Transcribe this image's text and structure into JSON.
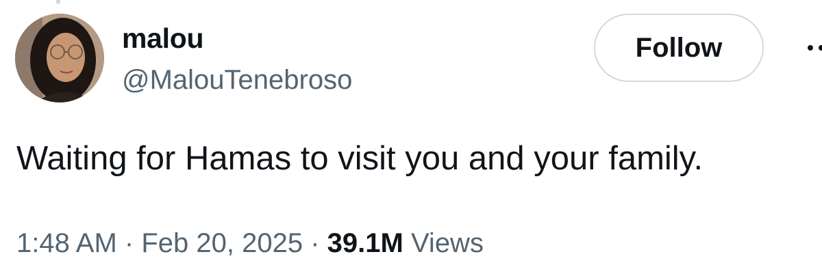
{
  "author": {
    "display_name": "malou",
    "handle": "@MalouTenebroso"
  },
  "follow_button": {
    "label": "Follow"
  },
  "tweet": {
    "text": "Waiting for Hamas to visit you and your family."
  },
  "meta": {
    "time": "1:48 AM",
    "separator": "·",
    "date": "Feb 20, 2025",
    "views_count": "39.1M",
    "views_label": "Views"
  },
  "icons": {
    "more": "more-horizontal-icon"
  },
  "colors": {
    "primary_text": "#0f1419",
    "secondary_text": "#536471",
    "border": "#cfd9de"
  }
}
